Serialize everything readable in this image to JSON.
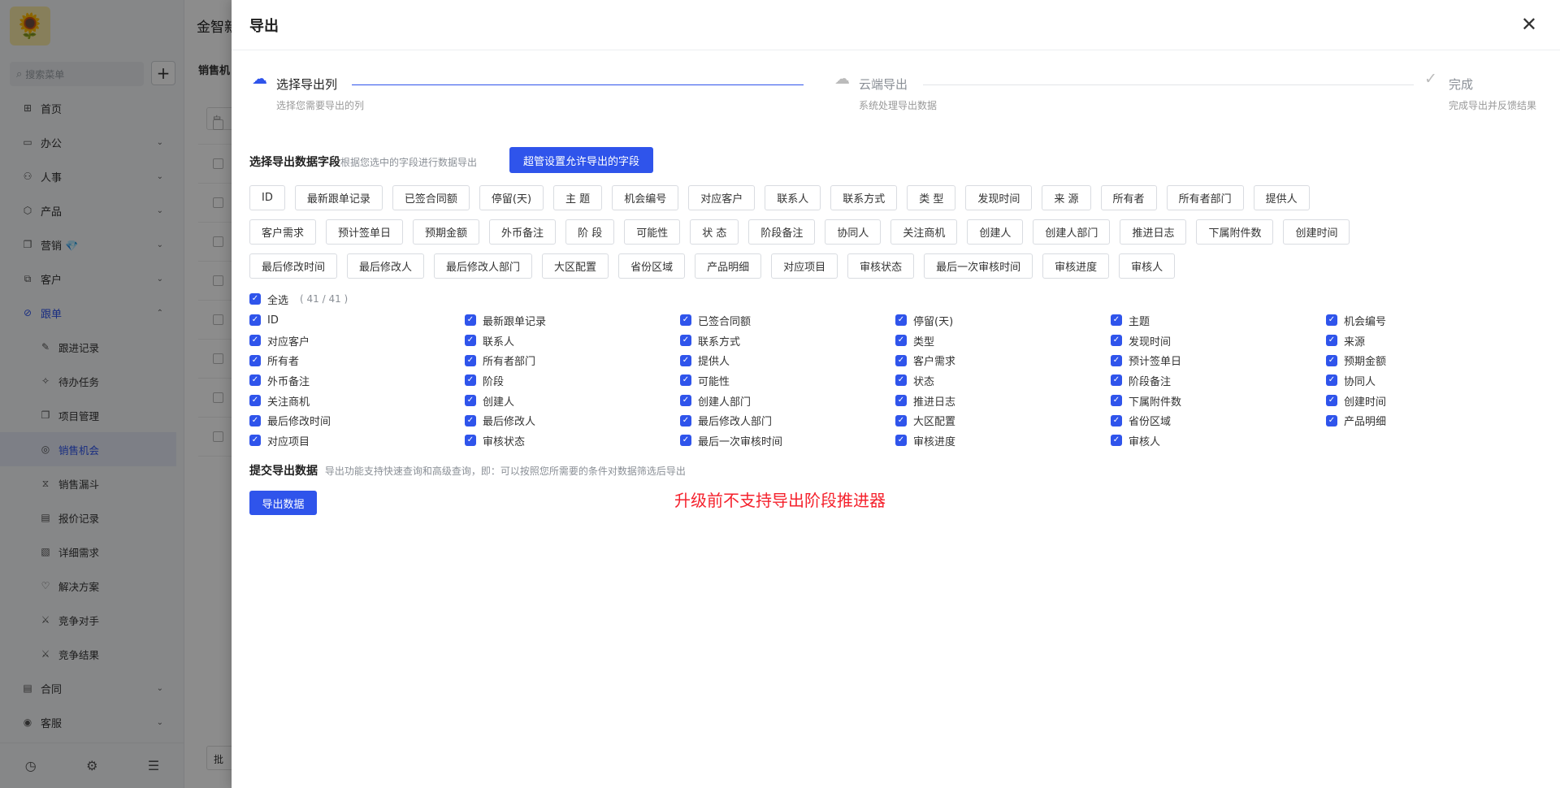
{
  "app": {
    "top_title": "金智新",
    "crumb": "销售机",
    "search_placeholder": "搜索菜单",
    "filter_placeholder": "自",
    "batch_label": "批"
  },
  "sidebar": {
    "items": [
      {
        "label": "首页",
        "icon": "home-icon",
        "glyph": "⊞"
      },
      {
        "label": "办公",
        "icon": "office-icon",
        "glyph": "▭",
        "chev": "⌄"
      },
      {
        "label": "人事",
        "icon": "hr-icon",
        "glyph": "⚇",
        "chev": "⌄"
      },
      {
        "label": "产品",
        "icon": "product-icon",
        "glyph": "⬡",
        "chev": "⌄"
      },
      {
        "label": "营销 💎",
        "icon": "marketing-icon",
        "glyph": "❐",
        "chev": "⌄"
      },
      {
        "label": "客户",
        "icon": "customer-icon",
        "glyph": "⧉",
        "chev": "⌄"
      },
      {
        "label": "跟单",
        "icon": "follow-icon",
        "glyph": "⊘",
        "chev": "⌃"
      }
    ],
    "sub_items": [
      {
        "label": "跟进记录",
        "icon": "record-icon",
        "glyph": "✎"
      },
      {
        "label": "待办任务",
        "icon": "task-icon",
        "glyph": "✧"
      },
      {
        "label": "项目管理",
        "icon": "project-icon",
        "glyph": "❐"
      },
      {
        "label": "销售机会",
        "icon": "opportunity-icon",
        "glyph": "◎"
      },
      {
        "label": "销售漏斗",
        "icon": "funnel-icon",
        "glyph": "⧖"
      },
      {
        "label": "报价记录",
        "icon": "quote-icon",
        "glyph": "▤"
      },
      {
        "label": "详细需求",
        "icon": "demand-icon",
        "glyph": "▧"
      },
      {
        "label": "解决方案",
        "icon": "solution-icon",
        "glyph": "♡"
      },
      {
        "label": "竞争对手",
        "icon": "competitor-icon",
        "glyph": "⚔"
      },
      {
        "label": "竞争结果",
        "icon": "result-icon",
        "glyph": "⚔"
      }
    ],
    "tail_items": [
      {
        "label": "合同",
        "icon": "contract-icon",
        "glyph": "▤",
        "chev": "⌄"
      },
      {
        "label": "客服",
        "icon": "service-icon",
        "glyph": "◉",
        "chev": "⌄"
      }
    ]
  },
  "drawer": {
    "title": "导出",
    "close": "✕",
    "steps": [
      {
        "title": "选择导出列",
        "desc": "选择您需要导出的列",
        "icon": "cloud-upload-icon",
        "glyph": "☁",
        "status": "active"
      },
      {
        "title": "云端导出",
        "desc": "系统处理导出数据",
        "icon": "cloud-icon",
        "glyph": "☁",
        "status": "wait"
      },
      {
        "title": "完成",
        "desc": "完成导出并反馈结果",
        "icon": "check-circle-icon",
        "glyph": "✓",
        "status": "wait"
      }
    ],
    "fields_title": "选择导出数据字段",
    "fields_sub": "根据您选中的字段进行数据导出",
    "admin_btn": "超管设置允许导出的字段",
    "tags": [
      "ID",
      "最新跟单记录",
      "已签合同额",
      "停留(天)",
      "主 题",
      "机会编号",
      "对应客户",
      "联系人",
      "联系方式",
      "类 型",
      "发现时间",
      "来 源",
      "所有者",
      "所有者部门",
      "提供人",
      "客户需求",
      "预计签单日",
      "预期金额",
      "外币备注",
      "阶 段",
      "可能性",
      "状 态",
      "阶段备注",
      "协同人",
      "关注商机",
      "创建人",
      "创建人部门",
      "推进日志",
      "下属附件数",
      "创建时间",
      "最后修改时间",
      "最后修改人",
      "最后修改人部门",
      "大区配置",
      "省份区域",
      "产品明细",
      "对应项目",
      "审核状态",
      "最后一次审核时间",
      "审核进度",
      "审核人"
    ],
    "select_all": "全选",
    "count": "( 41 / 41 )",
    "checkboxes": [
      "ID",
      "最新跟单记录",
      "已签合同额",
      "停留(天)",
      "主题",
      "机会编号",
      "对应客户",
      "联系人",
      "联系方式",
      "类型",
      "发现时间",
      "来源",
      "所有者",
      "所有者部门",
      "提供人",
      "客户需求",
      "预计签单日",
      "预期金额",
      "外币备注",
      "阶段",
      "可能性",
      "状态",
      "阶段备注",
      "协同人",
      "关注商机",
      "创建人",
      "创建人部门",
      "推进日志",
      "下属附件数",
      "创建时间",
      "最后修改时间",
      "最后修改人",
      "最后修改人部门",
      "大区配置",
      "省份区域",
      "产品明细",
      "对应项目",
      "审核状态",
      "最后一次审核时间",
      "审核进度",
      "审核人"
    ],
    "submit_title": "提交导出数据",
    "submit_sub": "导出功能支持快速查询和高级查询，即：可以按照您所需要的条件对数据筛选后导出",
    "export_btn": "导出数据",
    "warning": "升级前不支持导出阶段推进器",
    "colors": {
      "primary": "#2f54eb",
      "warning": "#f5222d"
    }
  }
}
